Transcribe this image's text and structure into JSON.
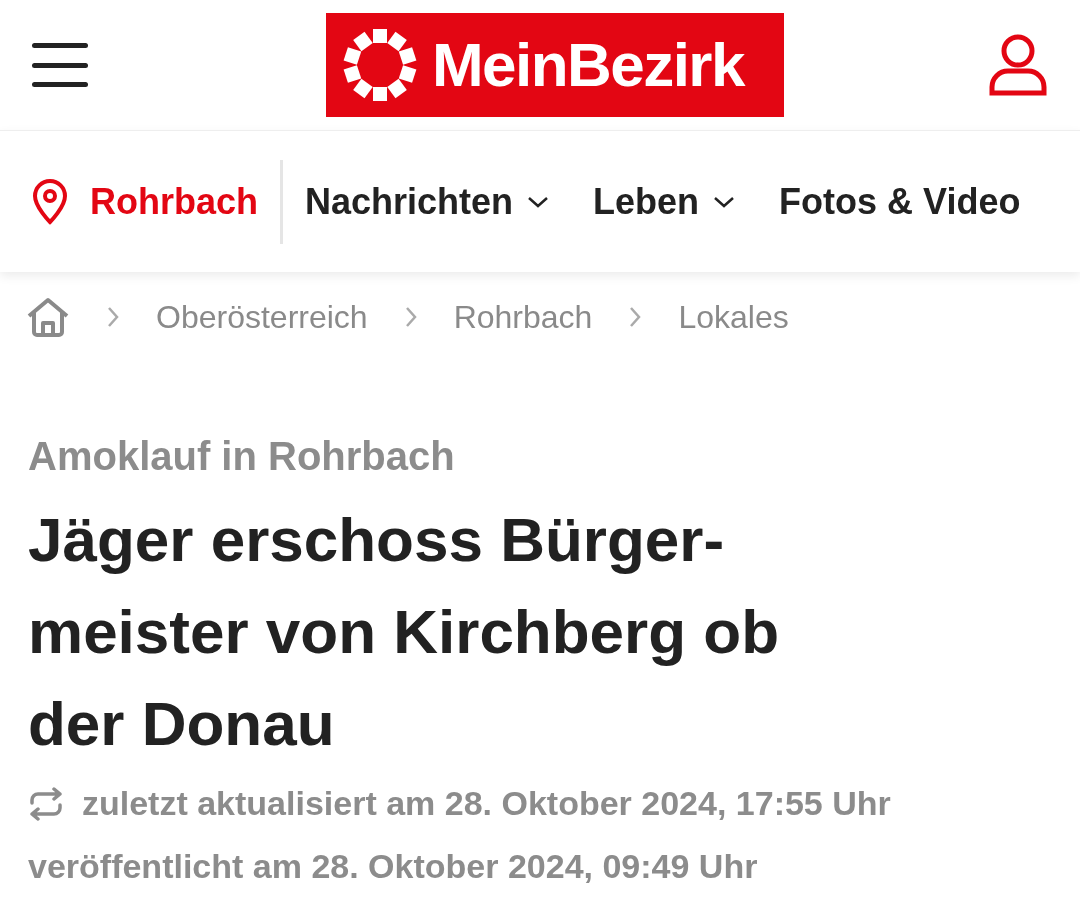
{
  "header": {
    "logo": "MeinBezirk"
  },
  "nav": {
    "region": "Rohrbach",
    "items": [
      {
        "label": "Nachrichten",
        "has_dropdown": true
      },
      {
        "label": "Leben",
        "has_dropdown": true
      },
      {
        "label": "Fotos & Video",
        "has_dropdown": false
      }
    ]
  },
  "breadcrumb": [
    "Oberösterreich",
    "Rohrbach",
    "Lokales"
  ],
  "article": {
    "kicker": "Amoklauf in Rohrbach",
    "title": "Jäger erschoss Bürger-meister von Kirchberg ob der Donau",
    "updated": "zuletzt aktualisiert am 28. Oktober 2024, 17:55 Uhr",
    "published": "veröffentlicht am 28. Oktober 2024, 09:49 Uhr"
  }
}
